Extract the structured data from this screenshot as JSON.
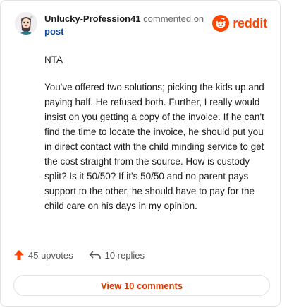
{
  "comment": {
    "username": "Unlucky-Profession41",
    "commented_on": "commented on",
    "post_link": "post",
    "paragraphs": [
      "NTA",
      "You've offered two solutions; picking the kids up and paying half. He refused both. Further, I really would insist on you getting a copy of the invoice. If he can't find the time to locate the invoice, he should put you in direct contact with the child minding service to get the cost straight from the source. How is custody split? Is it 50/50? If it's 50/50 and no parent pays support to the other, he should have to pay for the child care on his days in my opinion."
    ]
  },
  "brand": {
    "wordmark": "reddit",
    "color": "#ff4500"
  },
  "actions": {
    "upvotes": "45 upvotes",
    "replies": "10 replies",
    "upvote_color": "#ff4500"
  },
  "view_button": {
    "label": "View 10 comments",
    "color": "#d93a00"
  },
  "icons": [
    "avatar",
    "reddit-snoo-icon",
    "upvote-arrow-icon",
    "reply-arrow-icon"
  ]
}
